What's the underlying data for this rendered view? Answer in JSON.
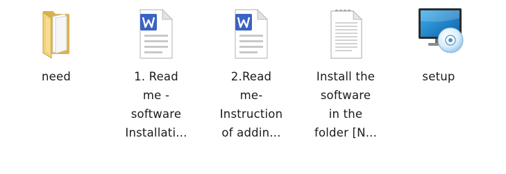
{
  "files": [
    {
      "icon": "folder-icon",
      "label_lines": [
        "need"
      ]
    },
    {
      "icon": "word-document-icon",
      "label_lines": [
        "1. Read",
        "me -",
        "software",
        "Installati..."
      ]
    },
    {
      "icon": "word-document-icon",
      "label_lines": [
        "2.Read",
        "me-",
        "Instruction",
        "of addin..."
      ]
    },
    {
      "icon": "text-document-icon",
      "label_lines": [
        "Install the",
        "software",
        "in the",
        "folder [N..."
      ]
    },
    {
      "icon": "setup-installer-icon",
      "label_lines": [
        "setup"
      ]
    }
  ],
  "colors": {
    "background": "#ffffff",
    "text": "#1a1a1a",
    "folder": "#e9c868",
    "word_badge": "#3b63c4",
    "monitor_screen": "#1a7fc8"
  }
}
